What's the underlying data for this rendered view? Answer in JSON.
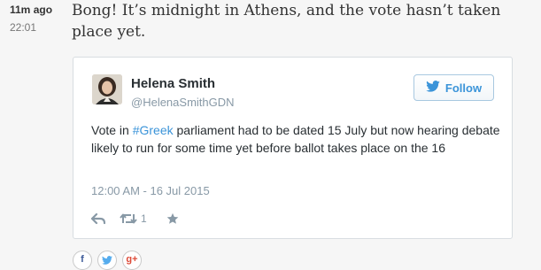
{
  "entry": {
    "relative_time": "11m ago",
    "clock_time": "22:01",
    "text": "Bong! It’s midnight in Athens, and the vote hasn’t taken place yet."
  },
  "tweet": {
    "author_name": "Helena Smith",
    "author_handle": "@HelenaSmithGDN",
    "follow_label": "Follow",
    "body_before": "Vote in ",
    "hashtag": "#Greek",
    "body_after": " parliament had to be dated 15 July but now hearing debate likely to run for some time yet before ballot takes place on the 16",
    "timestamp": "12:00 AM - 16 Jul 2015",
    "retweet_count": "1"
  },
  "share": {
    "facebook_glyph": "f",
    "google_plus_glyph": "g+"
  },
  "colors": {
    "link_blue": "#3b94d9",
    "action_grey": "#8899a6",
    "facebook": "#3b5998",
    "twitter": "#55acee",
    "google_plus": "#dd4b39"
  },
  "icons": [
    "twitter-bird-icon",
    "reply-icon",
    "retweet-icon",
    "favorite-star-icon",
    "facebook-icon",
    "twitter-icon",
    "google-plus-icon"
  ]
}
